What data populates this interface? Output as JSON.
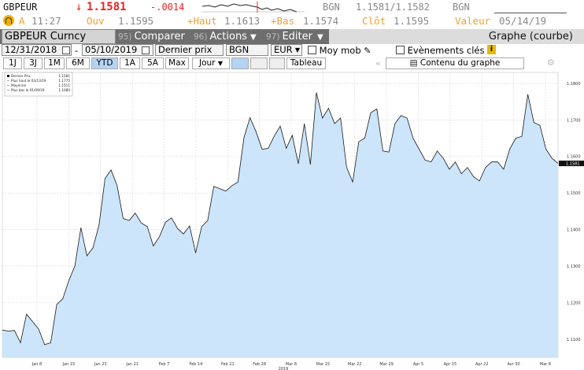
{
  "quote": {
    "symbol": "GBPEUR",
    "arrow": "↓",
    "last": "1.1581",
    "change": "-.0014",
    "source": "BGN",
    "bid_ask": "1.1581/1.1582",
    "source2": "BGN",
    "time_prefix": "A",
    "time": "11:27",
    "open_label": "Ouv",
    "open": "1.1595",
    "high_label": "+Haut",
    "high": "1.1613",
    "low_label": "+Bas",
    "low": "1.1574",
    "close_label": "Clôt",
    "close": "1.1595",
    "value_label": "Valeur",
    "value_date": "05/14/19"
  },
  "toolbar": {
    "ticker": "GBPEUR Curncy",
    "compare_num": "95)",
    "compare": "Comparer",
    "actions_num": "96)",
    "actions": "Actions",
    "edit_num": "97)",
    "edit": "Editer",
    "title": "Graphe (courbe)"
  },
  "settings": {
    "start_date": "12/31/2018",
    "dash": "-",
    "end_date": "05/10/2019",
    "price_field": "Dernier prix",
    "source": "BGN",
    "currency": "EUR",
    "moving_avg": "Moy mob",
    "key_events": "Evènements clés"
  },
  "periods": {
    "items": [
      "1J",
      "3J",
      "1M",
      "6M",
      "YTD",
      "1A",
      "5A",
      "Max"
    ],
    "active": "YTD",
    "interval": "Jour",
    "table": "Tableau",
    "content": "Contenu du graphe"
  },
  "colors": {
    "accent_down": "#e8231f",
    "label_orange": "#f0a030",
    "area_fill": "#cce5fa",
    "line": "#1a1a1a"
  },
  "chart_data": {
    "type": "area",
    "legend": [
      {
        "label": "Dernier Prix",
        "value": "1.1581"
      },
      {
        "label": "Plus haut le 03/13/19",
        "value": "1.1775"
      },
      {
        "label": "Moyenne",
        "value": "1.1511"
      },
      {
        "label": "Plus bas le 01/09/19",
        "value": "1.1080"
      }
    ],
    "legend_position": "top-left",
    "y_ticks": [
      "1.1800",
      "1.1700",
      "1.1600",
      "1.1500",
      "1.1400",
      "1.1300",
      "1.1200",
      "1.1100"
    ],
    "ylim": [
      1.105,
      1.183
    ],
    "x_ticks": [
      "Jan 8",
      "Jan 15",
      "Jan 23",
      "Jan 21",
      "Feb 7",
      "Feb 14",
      "Feb 21",
      "Feb 28",
      "Mar 8",
      "Mar 15",
      "Mar 22",
      "Mar 29",
      "Apr 5",
      "Apr 15",
      "Apr 22",
      "Avr 30",
      "Mar 8"
    ],
    "year_label": "2019",
    "last_tag": "1.1581",
    "grid": true,
    "values": [
      1.1125,
      1.1122,
      1.1124,
      1.109,
      1.1168,
      1.1148,
      1.1128,
      1.1085,
      1.109,
      1.1195,
      1.121,
      1.126,
      1.13,
      1.1405,
      1.1328,
      1.135,
      1.1412,
      1.154,
      1.1563,
      1.152,
      1.143,
      1.1425,
      1.1445,
      1.1418,
      1.1408,
      1.1355,
      1.138,
      1.142,
      1.1432,
      1.1403,
      1.1388,
      1.141,
      1.1336,
      1.1408,
      1.1425,
      1.1518,
      1.1512,
      1.1505,
      1.152,
      1.153,
      1.1652,
      1.1706,
      1.1668,
      1.162,
      1.1622,
      1.1655,
      1.1683,
      1.1622,
      1.1658,
      1.158,
      1.169,
      1.1578,
      1.1775,
      1.1705,
      1.1732,
      1.169,
      1.1705,
      1.157,
      1.153,
      1.164,
      1.165,
      1.172,
      1.173,
      1.1615,
      1.1612,
      1.169,
      1.1712,
      1.1705,
      1.165,
      1.162,
      1.159,
      1.1585,
      1.1615,
      1.1595,
      1.1565,
      1.1585,
      1.1553,
      1.157,
      1.1545,
      1.1533,
      1.157,
      1.1585,
      1.1585,
      1.1565,
      1.162,
      1.165,
      1.1655,
      1.177,
      1.1693,
      1.1685,
      1.162,
      1.1595,
      1.1581
    ]
  }
}
